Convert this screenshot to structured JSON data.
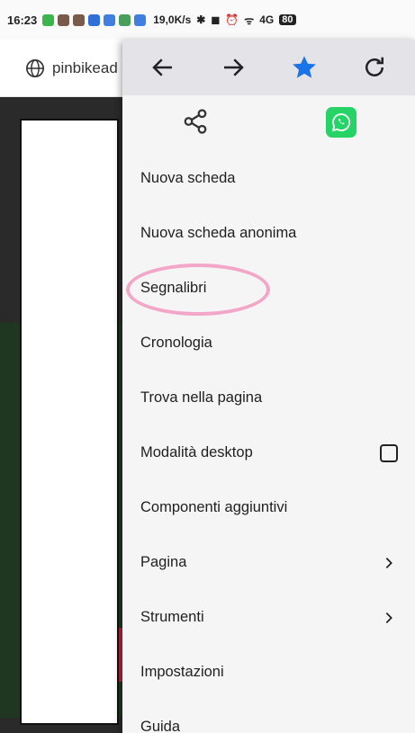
{
  "status_bar": {
    "time": "16:23",
    "network_speed": "19,0K/s",
    "network": "4G",
    "battery": "80"
  },
  "address_bar": {
    "url": "pinbikead"
  },
  "toolbar": {
    "back": "arrow-left-icon",
    "forward": "arrow-right-icon",
    "bookmark": "star-icon",
    "reload": "refresh-icon"
  },
  "menu": {
    "share_icon": "share-icon",
    "whatsapp_icon": "whatsapp-icon",
    "items": [
      {
        "label": "Nuova scheda"
      },
      {
        "label": "Nuova scheda anonima"
      },
      {
        "label": "Segnalibri"
      },
      {
        "label": "Cronologia"
      },
      {
        "label": "Trova nella pagina"
      },
      {
        "label": "Modalità desktop",
        "trailing": "checkbox",
        "checked": false
      },
      {
        "label": "Componenti aggiuntivi"
      },
      {
        "label": "Pagina",
        "trailing": "chevron-right-icon"
      },
      {
        "label": "Strumenti",
        "trailing": "chevron-right-icon"
      },
      {
        "label": "Impostazioni"
      },
      {
        "label": "Guida"
      }
    ]
  },
  "colors": {
    "accent": "#1a73e8",
    "annotation": "#f3a6c8",
    "whatsapp": "#25d366"
  }
}
